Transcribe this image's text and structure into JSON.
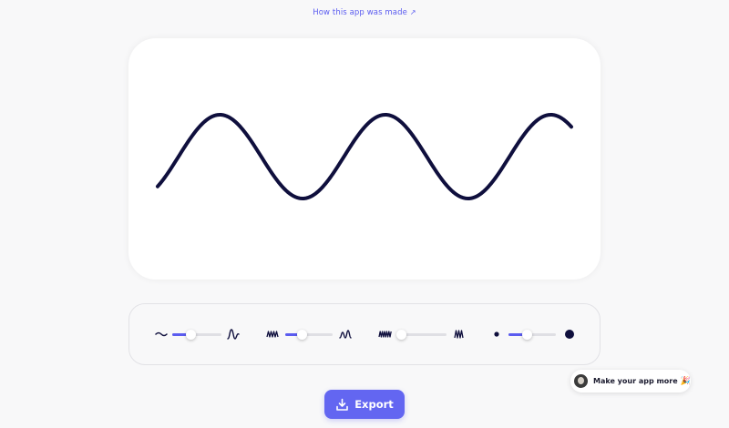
{
  "header": {
    "link_text": "How this app was made",
    "link_arrow": "↗"
  },
  "canvas": {
    "wave": {
      "cycles": 2.5,
      "line_color": "#0f0f3d"
    }
  },
  "controls": {
    "accent_color": "#5b5cf0",
    "sliders": [
      {
        "name": "amplitude",
        "min_icon": "small-wave-icon",
        "max_icon": "tall-wave-icon",
        "value": 0.38
      },
      {
        "name": "frequency",
        "min_icon": "zigzag-low-icon",
        "max_icon": "wave-high-icon",
        "value": 0.35
      },
      {
        "name": "noise",
        "min_icon": "zigzag-dense-icon",
        "max_icon": "zigzag-compact-icon",
        "value": 0.0
      },
      {
        "name": "thickness",
        "min_icon": "small-dot-icon",
        "max_icon": "large-dot-icon",
        "value": 0.4
      }
    ]
  },
  "export": {
    "label": "Export",
    "icon": "download-icon"
  },
  "badge": {
    "label": "Make your app more",
    "emoji": "🎉"
  }
}
